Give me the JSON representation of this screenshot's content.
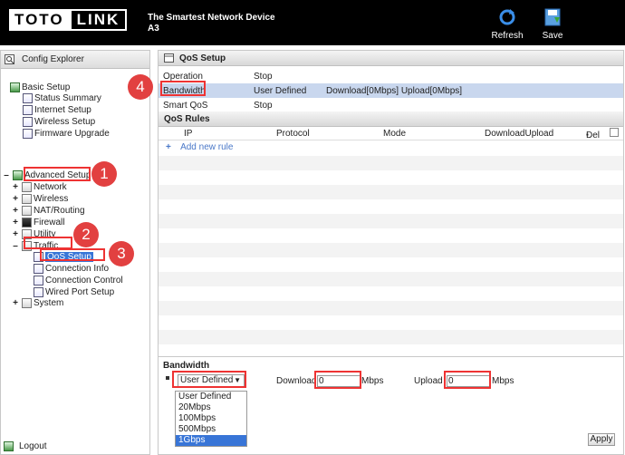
{
  "header": {
    "logo_left": "TOTO",
    "logo_right": "LINK",
    "tagline": "The Smartest Network Device",
    "model": "A3",
    "refresh_label": "Refresh",
    "save_label": "Save"
  },
  "sidebar": {
    "title": "Config Explorer",
    "basic_setup": "Basic Setup",
    "basic_items": [
      "Status Summary",
      "Internet Setup",
      "Wireless Setup",
      "Firmware Upgrade"
    ],
    "advanced_setup": "Advanced Setup",
    "advanced_items": [
      "Network",
      "Wireless",
      "NAT/Routing",
      "Firewall",
      "Utility"
    ],
    "traffic": "Traffic",
    "traffic_items": [
      "QoS Setup",
      "Connection Info",
      "Connection Control",
      "Wired Port Setup"
    ],
    "system": "System",
    "logout": "Logout"
  },
  "qos": {
    "title": "QoS Setup",
    "operation_label": "Operation",
    "operation_value": "Stop",
    "bandwidth_label": "Bandwidth",
    "bandwidth_value": "User Defined",
    "bandwidth_detail": "Download[0Mbps] Upload[0Mbps]",
    "smart_label": "Smart QoS",
    "smart_value": "Stop"
  },
  "rules": {
    "title": "QoS Rules",
    "col_ip": "IP",
    "col_protocol": "Protocol",
    "col_mode": "Mode",
    "col_du": "DownloadUpload",
    "col_del": "Del",
    "add_plus": "+",
    "add_label": "Add new rule"
  },
  "bw_form": {
    "title": "Bandwidth",
    "selected": "User Defined",
    "options": [
      "User Defined",
      "20Mbps",
      "100Mbps",
      "500Mbps",
      "1Gbps"
    ],
    "download_label": "Download",
    "download_value": "0",
    "mbps1": "Mbps",
    "upload_label": "Upload",
    "upload_value": "0",
    "mbps2": "Mbps",
    "apply_label": "Apply"
  },
  "annotations": [
    "1",
    "2",
    "3",
    "4"
  ],
  "colors": {
    "accent": "#3875d7",
    "marker": "#e24040",
    "row_highlight": "#c9d7ee"
  }
}
